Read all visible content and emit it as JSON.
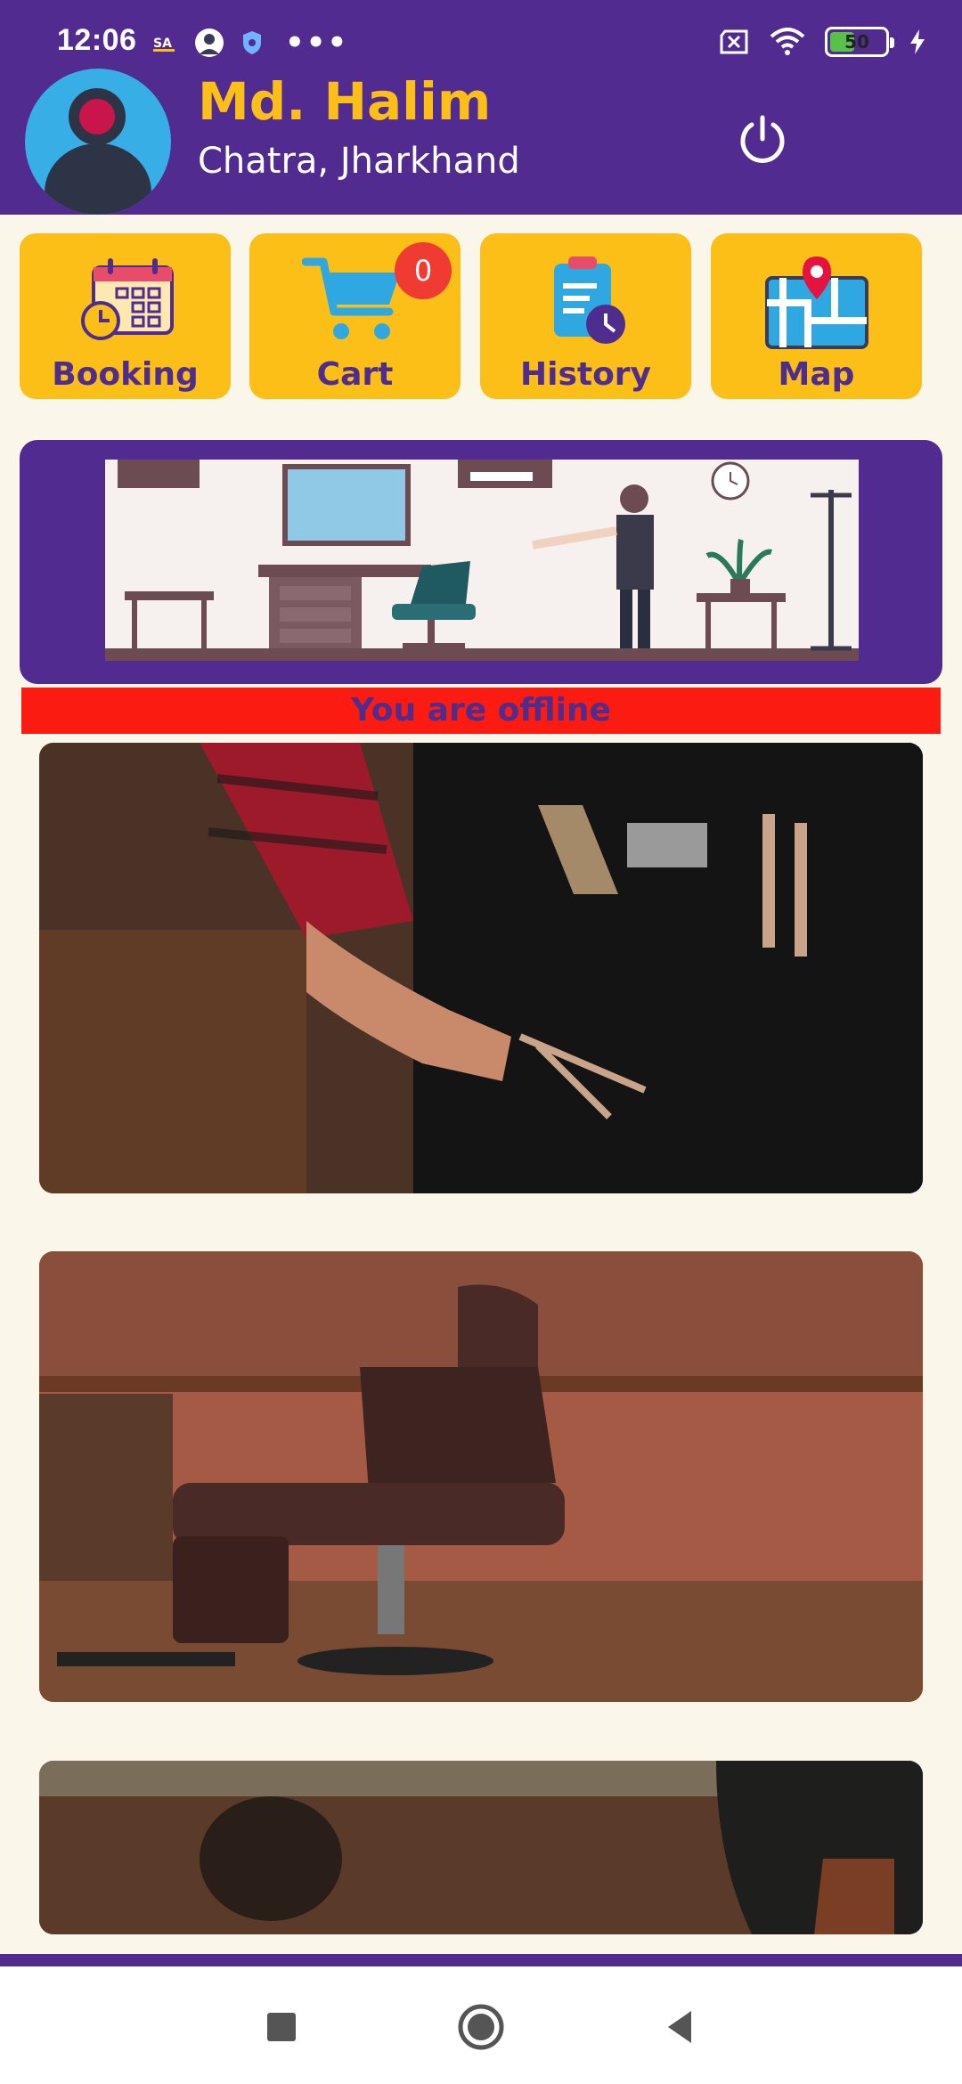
{
  "status_bar": {
    "time": "12:06",
    "dots": "•••",
    "battery_level": "50",
    "battery_fraction": 0.5,
    "icons": [
      "notification-icon",
      "avatar-status-icon",
      "shield-status-icon",
      "sim-off-icon",
      "wifi-icon",
      "battery-icon",
      "charging-icon"
    ]
  },
  "header": {
    "name": "Md. Halim",
    "location": "Chatra, Jharkhand",
    "power_icon": "power-icon",
    "name_color": "#fbbf18",
    "bg_color": "#522b91"
  },
  "tiles": [
    {
      "label": "Booking",
      "icon": "calendar-clock-icon"
    },
    {
      "label": "Cart",
      "icon": "cart-icon",
      "badge": "0"
    },
    {
      "label": "History",
      "icon": "clipboard-clock-icon"
    },
    {
      "label": "Map",
      "icon": "map-pin-icon"
    }
  ],
  "offline_banner": {
    "text": "You are offline",
    "bg_color": "#fc1b10"
  },
  "photos": [
    "barber-with-scissors-photo",
    "barber-chair-photo",
    "barber-shop-photo"
  ],
  "nav": [
    "recents-button",
    "home-button",
    "back-button"
  ]
}
